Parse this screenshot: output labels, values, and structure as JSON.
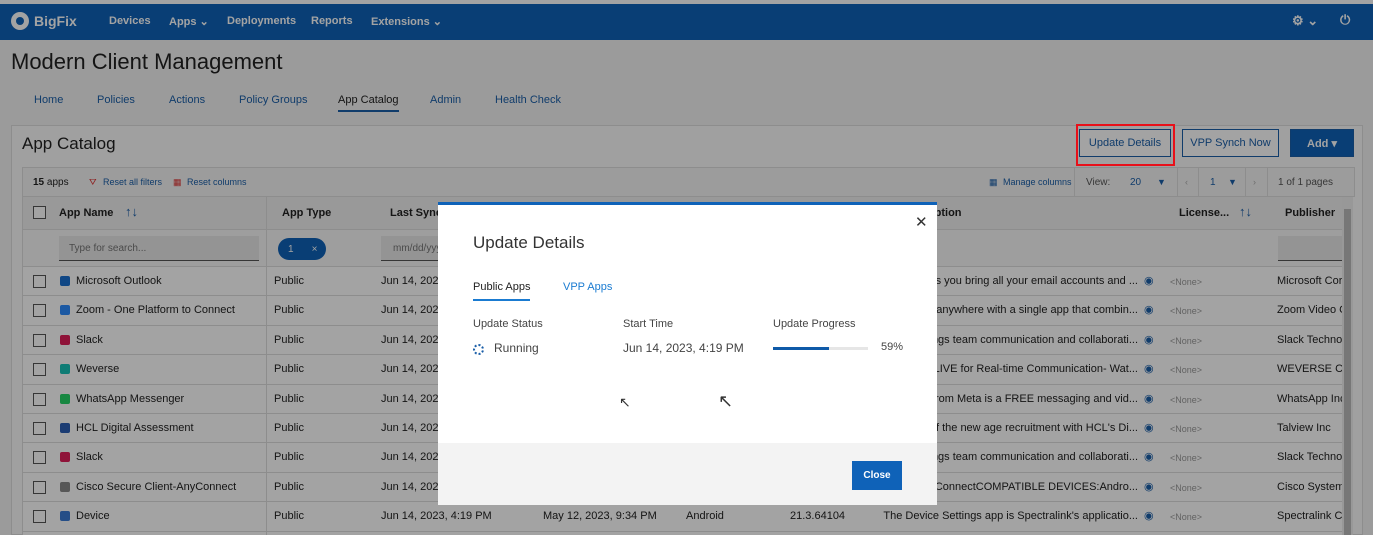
{
  "nav": {
    "brand": "BigFix",
    "items": [
      "Devices",
      "Apps ⌄",
      "Deployments",
      "Reports",
      "Extensions ⌄"
    ],
    "gear": "⚙ ⌄",
    "power": "⏻"
  },
  "page": {
    "title": "Modern Client Management",
    "tabs": [
      "Home",
      "Policies",
      "Actions",
      "Policy Groups",
      "App Catalog",
      "Admin",
      "Health Check"
    ],
    "active_tab": "App Catalog"
  },
  "catalog": {
    "title": "App Catalog",
    "buttons": {
      "update_details": "Update Details",
      "vpp_synch": "VPP Synch Now",
      "add": "Add ▾"
    },
    "toolbar": {
      "count": "15",
      "count_label": "apps",
      "reset_filters": "Reset all filters",
      "reset_columns": "Reset columns",
      "manage_columns": "Manage columns",
      "view_label": "View:",
      "view_value": "20",
      "page_value": "1",
      "pages": "1 of 1 pages"
    },
    "columns": {
      "app_name": "App Name",
      "app_type": "App Type",
      "last_synch": "Last Synch",
      "description": "Description",
      "license": "License...",
      "publisher": "Publisher"
    },
    "filters": {
      "search_placeholder": "Type for search...",
      "type_chip": "1",
      "date_placeholder": "mm/dd/yyyy"
    },
    "rows": [
      {
        "name": "Microsoft Outlook",
        "type": "Public",
        "last_synch": "Jun 14, 2023, 4:19 PM",
        "desc": "lets you bring all your email accounts and ...",
        "license": "<None>",
        "publisher": "Microsoft Cor",
        "color": "#1a6fd1"
      },
      {
        "name": "Zoom - One Platform to Connect",
        "type": "Public",
        "last_synch": "Jun 14, 2023, 4:19 PM",
        "desc": "om anywhere with a single app that combin...",
        "license": "<None>",
        "publisher": "Zoom Video C",
        "color": "#2d8cff"
      },
      {
        "name": "Slack",
        "type": "Public",
        "last_synch": "Jun 14, 2023, 4:19 PM",
        "desc": "ings team communication and collaborati...",
        "license": "<None>",
        "publisher": "Slack Technol",
        "color": "#e01e5a"
      },
      {
        "name": "Weverse",
        "type": "Public",
        "last_synch": "Jun 14, 2023, 4:19 PM",
        "desc": "se LIVE for Real-time Communication- Wat...",
        "license": "<None>",
        "publisher": "WEVERSE COI",
        "color": "#18c3b8"
      },
      {
        "name": "WhatsApp Messenger",
        "type": "Public",
        "last_synch": "Jun 14, 2023, 4:19 PM",
        "desc": "pp from Meta is a FREE messaging and vid...",
        "license": "<None>",
        "publisher": "WhatsApp Inc",
        "color": "#25d366"
      },
      {
        "name": "HCL Digital Assessment",
        "type": "Public",
        "last_synch": "Jun 14, 2023, 4:19 PM",
        "desc": "t of the new age recruitment with HCL's Di...",
        "license": "<None>",
        "publisher": "Talview Inc",
        "color": "#2b5fb4"
      },
      {
        "name": "Slack",
        "type": "Public",
        "last_synch": "Jun 14, 2023, 4:19 PM",
        "desc": "ings team communication and collaborati...",
        "license": "<None>",
        "publisher": "Slack Technol",
        "color": "#e01e5a"
      },
      {
        "name": "Cisco Secure Client-AnyConnect",
        "type": "Public",
        "last_synch": "Jun 14, 2023, 4:19 PM",
        "desc": "y AnyConnectCOMPATIBLE DEVICES:Andro...",
        "license": "<None>",
        "publisher": "Cisco System",
        "color": "#888888"
      },
      {
        "name": "Device",
        "type": "Public",
        "last_synch": "Jun 14, 2023, 4:19 PM",
        "col4": "May 12, 2023, 9:34 PM",
        "platform": "Android",
        "version": "21.3.64104",
        "desc": "The Device Settings app is Spectralink's applicatio...",
        "license": "<None>",
        "publisher": "Spectralink Co",
        "color": "#3b7bd4"
      }
    ]
  },
  "modal": {
    "title": "Update Details",
    "tabs": [
      "Public Apps",
      "VPP Apps"
    ],
    "active_tab": "Public Apps",
    "headers": {
      "status": "Update Status",
      "start": "Start Time",
      "progress": "Update Progress"
    },
    "status": "Running",
    "start_time": "Jun 14, 2023, 4:19 PM",
    "progress_percent": 59,
    "progress_label": "59%",
    "close": "Close"
  },
  "colors": {
    "brand": "#0f62b8",
    "highlight": "#e8101a"
  }
}
